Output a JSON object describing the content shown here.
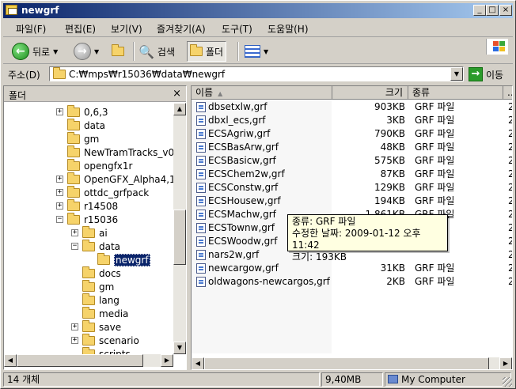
{
  "window": {
    "title": "newgrf"
  },
  "menu": [
    "파일(F)",
    "편집(E)",
    "보기(V)",
    "즐겨찾기(A)",
    "도구(T)",
    "도움말(H)"
  ],
  "toolbar": {
    "back": "뒤로",
    "search": "검색",
    "folders": "폴더"
  },
  "address": {
    "label": "주소(D)",
    "path": "C:₩mps₩r15036₩data₩newgrf",
    "go": "이동"
  },
  "folder_pane": {
    "title": "폴더",
    "close": "×"
  },
  "tree": [
    {
      "label": "0,6,3",
      "exp": "+"
    },
    {
      "label": "data",
      "exp": ""
    },
    {
      "label": "gm",
      "exp": ""
    },
    {
      "label": "NewTramTracks_v0",
      "exp": ""
    },
    {
      "label": "opengfx1r",
      "exp": ""
    },
    {
      "label": "OpenGFX_Alpha4,1",
      "exp": "+"
    },
    {
      "label": "ottdc_grfpack",
      "exp": "+"
    },
    {
      "label": "r14508",
      "exp": "+"
    },
    {
      "label": "r15036",
      "exp": "−"
    },
    {
      "label": "ai",
      "exp": "+"
    },
    {
      "label": "data",
      "exp": "−"
    },
    {
      "label": "newgrf",
      "exp": "",
      "selected": true
    },
    {
      "label": "docs",
      "exp": ""
    },
    {
      "label": "gm",
      "exp": ""
    },
    {
      "label": "lang",
      "exp": ""
    },
    {
      "label": "media",
      "exp": ""
    },
    {
      "label": "save",
      "exp": "+"
    },
    {
      "label": "scenario",
      "exp": "+"
    },
    {
      "label": "scripts",
      "exp": ""
    }
  ],
  "columns": {
    "name": "이름",
    "size": "크기",
    "type": "종류",
    "extra": "..."
  },
  "files": [
    {
      "name": "dbsetxlw,grf",
      "size": "903KB",
      "type": "GRF 파일",
      "x": "2"
    },
    {
      "name": "dbxl_ecs,grf",
      "size": "3KB",
      "type": "GRF 파일",
      "x": "2"
    },
    {
      "name": "ECSAgriw,grf",
      "size": "790KB",
      "type": "GRF 파일",
      "x": "2"
    },
    {
      "name": "ECSBasArw,grf",
      "size": "48KB",
      "type": "GRF 파일",
      "x": "2"
    },
    {
      "name": "ECSBasicw,grf",
      "size": "575KB",
      "type": "GRF 파일",
      "x": "2"
    },
    {
      "name": "ECSChem2w,grf",
      "size": "87KB",
      "type": "GRF 파일",
      "x": "2"
    },
    {
      "name": "ECSConstw,grf",
      "size": "129KB",
      "type": "GRF 파일",
      "x": "2"
    },
    {
      "name": "ECSHousew,grf",
      "size": "194KB",
      "type": "GRF 파일",
      "x": "2"
    },
    {
      "name": "ECSMachw,grf",
      "size": "1,861KB",
      "type": "GRF 파일",
      "x": "2"
    },
    {
      "name": "ECSTownw,grf",
      "size": "",
      "type": "",
      "x": "2"
    },
    {
      "name": "ECSWoodw,grf",
      "size": "",
      "type": "",
      "x": "2"
    },
    {
      "name": "nars2w,grf",
      "size": "",
      "type": "",
      "x": "2"
    },
    {
      "name": "newcargow,grf",
      "size": "31KB",
      "type": "GRF 파일",
      "x": "2"
    },
    {
      "name": "oldwagons-newcargos,grf",
      "size": "2KB",
      "type": "GRF 파일",
      "x": "2"
    }
  ],
  "tooltip": {
    "line1": "종류: GRF 파일",
    "line2": "수정한 날짜: 2009-01-12 오후 11:42",
    "line3": "크기: 193KB"
  },
  "status": {
    "count": "14 개체",
    "size": "9,40MB",
    "location": "My Computer"
  }
}
